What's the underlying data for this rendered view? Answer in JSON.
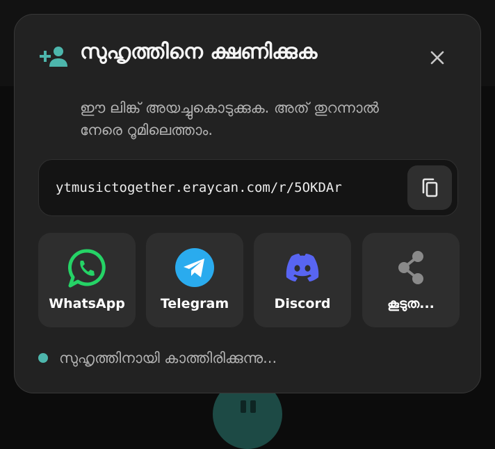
{
  "dialog": {
    "title": "സുഹൃത്തിനെ ക്ഷണിക്കുക",
    "subtitle": "ഈ ലിങ്ക് അയച്ചുകൊടുക്കുക. അത് തുറന്നാൽ നേരെ റൂമിലെത്താം.",
    "link": "ytmusictogether.eraycan.com/r/5OKDAr",
    "share_options": [
      {
        "label": "WhatsApp",
        "icon": "whatsapp-icon"
      },
      {
        "label": "Telegram",
        "icon": "telegram-icon"
      },
      {
        "label": "Discord",
        "icon": "discord-icon"
      },
      {
        "label": "കൂടുത...",
        "icon": "share-icon"
      }
    ],
    "status": "സുഹൃത്തിനായി കാത്തിരിക്കുന്നു..."
  },
  "icons": {
    "add_person": "person-add-icon",
    "close": "close-icon",
    "copy": "copy-icon"
  },
  "colors": {
    "accent": "#4db6ac",
    "whatsapp": "#25d366",
    "telegram": "#2aabee",
    "discord": "#5865f2",
    "dialog_background": "#222222"
  }
}
